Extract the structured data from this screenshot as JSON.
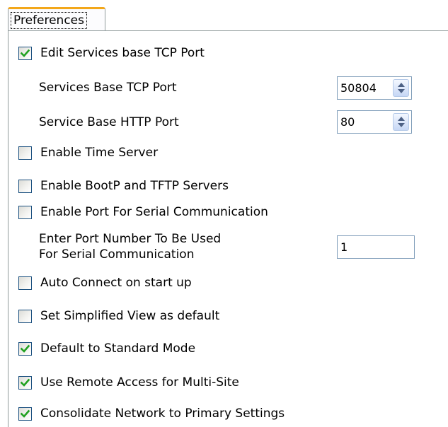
{
  "tab": {
    "label": "Preferences"
  },
  "edit_tcp": {
    "label": "Edit Services base TCP Port",
    "checked": true
  },
  "tcp_port": {
    "label": "Services Base TCP Port",
    "value": "50804"
  },
  "http_port": {
    "label": "Service Base HTTP Port",
    "value": "80"
  },
  "time_server": {
    "label": "Enable Time Server",
    "checked": false
  },
  "bootp": {
    "label": "Enable BootP and TFTP Servers",
    "checked": false
  },
  "serial_enable": {
    "label": "Enable Port For Serial Communication",
    "checked": false
  },
  "serial_port": {
    "label_line1": "Enter Port Number To Be Used",
    "label_line2": "For Serial Communication",
    "value": "1"
  },
  "auto_connect": {
    "label": "Auto Connect on start up",
    "checked": false
  },
  "simplified_view": {
    "label": "Set Simplified View as default",
    "checked": false
  },
  "standard_mode": {
    "label": "Default to Standard Mode",
    "checked": true
  },
  "remote_access": {
    "label": "Use Remote Access for Multi-Site",
    "checked": true
  },
  "consolidate": {
    "label": "Consolidate Network to Primary Settings",
    "checked": true
  },
  "colors": {
    "check": "#21a121",
    "tab_accent": "#f3a71a",
    "checkbox_border": "#1c5180"
  }
}
